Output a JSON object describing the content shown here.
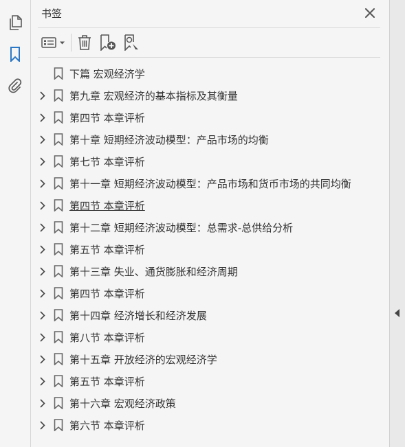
{
  "panel": {
    "title": "书签"
  },
  "toolbar": {
    "options_icon": "options-list-icon",
    "delete_icon": "trash-icon",
    "new_bookmark_icon": "new-bookmark-icon",
    "search_bookmark_icon": "bookmark-search-icon"
  },
  "left_rail": {
    "items": [
      "pages-icon",
      "bookmark-icon",
      "attachment-icon"
    ]
  },
  "colors": {
    "accent": "#2a78c5",
    "icon": "#5a5a5a",
    "background": "#f5f5f5"
  },
  "bookmarks": [
    {
      "label": "下篇  宏观经济学",
      "expandable": false,
      "underline": false
    },
    {
      "label": "第九章  宏观经济的基本指标及其衡量",
      "expandable": true,
      "underline": false
    },
    {
      "label": "第四节  本章评析",
      "expandable": true,
      "underline": false
    },
    {
      "label": "第十章  短期经济波动模型：产品市场的均衡",
      "expandable": true,
      "underline": false
    },
    {
      "label": "第七节  本章评析",
      "expandable": true,
      "underline": false
    },
    {
      "label": "第十一章  短期经济波动模型：产品市场和货币市场的共同均衡",
      "expandable": true,
      "underline": false
    },
    {
      "label": "第四节  本章评析",
      "expandable": true,
      "underline": true
    },
    {
      "label": "第十二章  短期经济波动模型：总需求-总供给分析",
      "expandable": true,
      "underline": false
    },
    {
      "label": "第五节  本章评析",
      "expandable": true,
      "underline": false
    },
    {
      "label": "第十三章  失业、通货膨胀和经济周期",
      "expandable": true,
      "underline": false
    },
    {
      "label": "第四节  本章评析",
      "expandable": true,
      "underline": false
    },
    {
      "label": "第十四章  经济增长和经济发展",
      "expandable": true,
      "underline": false
    },
    {
      "label": "第八节  本章评析",
      "expandable": true,
      "underline": false
    },
    {
      "label": "第十五章  开放经济的宏观经济学",
      "expandable": true,
      "underline": false
    },
    {
      "label": "第五节  本章评析",
      "expandable": true,
      "underline": false
    },
    {
      "label": "第十六章  宏观经济政策",
      "expandable": true,
      "underline": false
    },
    {
      "label": "第六节  本章评析",
      "expandable": true,
      "underline": false
    }
  ]
}
